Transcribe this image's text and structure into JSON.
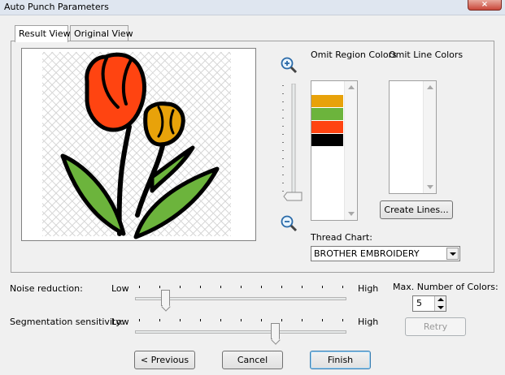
{
  "window": {
    "title": "Auto Punch Parameters",
    "close_symbol": "×"
  },
  "tabs": [
    {
      "label": "Result View",
      "active": true
    },
    {
      "label": "Original View",
      "active": false
    }
  ],
  "omit_region": {
    "label": "Omit Region Colors",
    "colors": [
      "#ffffff",
      "#e8a20a",
      "#6cb43c",
      "#ff4411",
      "#000000"
    ]
  },
  "omit_line": {
    "label": "Omit Line Colors"
  },
  "create_lines_label": "Create Lines...",
  "thread_chart": {
    "label": "Thread Chart:",
    "value": "BROTHER EMBROIDERY"
  },
  "noise": {
    "label": "Noise reduction:",
    "low": "Low",
    "high": "High",
    "level": 0.13
  },
  "segmentation": {
    "label": "Segmentation sensitivity:",
    "low": "Low",
    "high": "High",
    "level": 0.67
  },
  "max_colors": {
    "label": "Max. Number of Colors:",
    "value": "5"
  },
  "buttons": {
    "retry": "Retry",
    "previous": "< Previous",
    "cancel": "Cancel",
    "finish": "Finish"
  },
  "icons": {
    "zoom_in": "zoom-in-icon",
    "zoom_out": "zoom-out-icon"
  }
}
